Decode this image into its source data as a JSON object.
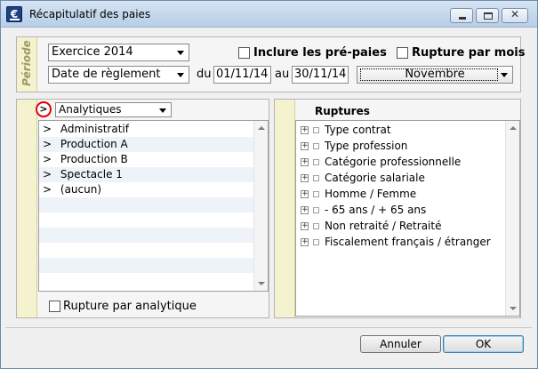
{
  "window": {
    "title": "Récapitulatif des paies"
  },
  "periode": {
    "strip_label": "Période",
    "exercice_value": "Exercice 2014",
    "date_type_value": "Date de règlement",
    "du_label": "du",
    "du_value": "01/11/14",
    "au_label": "au",
    "au_value": "30/11/14",
    "mois_value": "Novembre",
    "inclure_prepaies_label": "Inclure les pré-paies",
    "rupture_par_mois_label": "Rupture par mois"
  },
  "analytique": {
    "expand_glyph": ">",
    "dropdown_value": "Analytiques",
    "items": [
      {
        "marker": ">",
        "label": "Administratif"
      },
      {
        "marker": ">",
        "label": "Production A"
      },
      {
        "marker": ">",
        "label": "Production B"
      },
      {
        "marker": ">",
        "label": "Spectacle 1"
      },
      {
        "marker": ">",
        "label": "(aucun)"
      }
    ],
    "rupture_par_analytique_label": "Rupture par analytique"
  },
  "ruptures": {
    "title": "Ruptures",
    "items": [
      {
        "label": "Type contrat"
      },
      {
        "label": "Type profession"
      },
      {
        "label": "Catégorie professionnelle"
      },
      {
        "label": "Catégorie salariale"
      },
      {
        "label": "Homme / Femme"
      },
      {
        "label": "- 65 ans / + 65 ans"
      },
      {
        "label": "Non retraité / Retraité"
      },
      {
        "label": "Fiscalement français / étranger"
      }
    ]
  },
  "buttons": {
    "annuler": "Annuler",
    "ok": "OK"
  }
}
